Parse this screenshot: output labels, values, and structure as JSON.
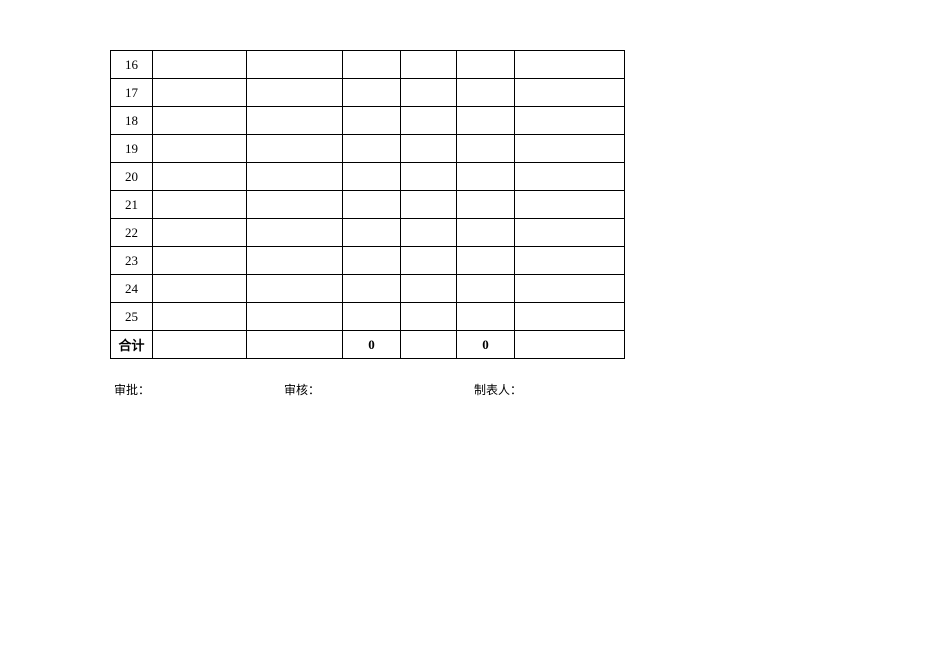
{
  "rows": [
    {
      "idx": "16",
      "c1": "",
      "c2": "",
      "c3": "",
      "c4": "",
      "c5": "",
      "c6": ""
    },
    {
      "idx": "17",
      "c1": "",
      "c2": "",
      "c3": "",
      "c4": "",
      "c5": "",
      "c6": ""
    },
    {
      "idx": "18",
      "c1": "",
      "c2": "",
      "c3": "",
      "c4": "",
      "c5": "",
      "c6": ""
    },
    {
      "idx": "19",
      "c1": "",
      "c2": "",
      "c3": "",
      "c4": "",
      "c5": "",
      "c6": ""
    },
    {
      "idx": "20",
      "c1": "",
      "c2": "",
      "c3": "",
      "c4": "",
      "c5": "",
      "c6": ""
    },
    {
      "idx": "21",
      "c1": "",
      "c2": "",
      "c3": "",
      "c4": "",
      "c5": "",
      "c6": ""
    },
    {
      "idx": "22",
      "c1": "",
      "c2": "",
      "c3": "",
      "c4": "",
      "c5": "",
      "c6": ""
    },
    {
      "idx": "23",
      "c1": "",
      "c2": "",
      "c3": "",
      "c4": "",
      "c5": "",
      "c6": ""
    },
    {
      "idx": "24",
      "c1": "",
      "c2": "",
      "c3": "",
      "c4": "",
      "c5": "",
      "c6": ""
    },
    {
      "idx": "25",
      "c1": "",
      "c2": "",
      "c3": "",
      "c4": "",
      "c5": "",
      "c6": ""
    }
  ],
  "total": {
    "label": "合计",
    "c1": "",
    "c2": "",
    "c3": "0",
    "c4": "",
    "c5": "0",
    "c6": ""
  },
  "signatures": {
    "approve_label": "审批：",
    "review_label": "审核：",
    "preparer_label": "制表人："
  }
}
